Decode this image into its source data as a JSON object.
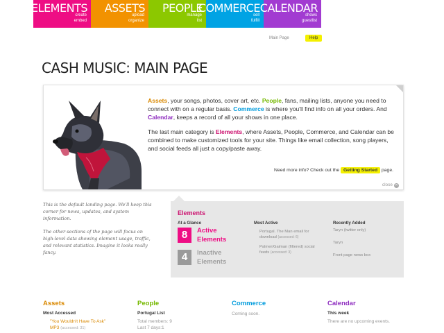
{
  "nav": {
    "tabs": [
      {
        "name": "Elements",
        "sub1": "create",
        "sub2": "embed",
        "color": "#ee0d84"
      },
      {
        "name": "Assets",
        "sub1": "upload",
        "sub2": "organize",
        "color": "#f29200"
      },
      {
        "name": "People",
        "sub1": "manage",
        "sub2": "list",
        "color": "#8cc800"
      },
      {
        "name": "Commerce",
        "sub1": "sell",
        "sub2": "fulfill",
        "color": "#00a3e4"
      },
      {
        "name": "Calendar",
        "sub1": "shows",
        "sub2": "guestlist",
        "color": "#a23bd1"
      }
    ]
  },
  "subnav": {
    "main_page": "Main Page",
    "help": "Help"
  },
  "page_title": "Cash Music: Main Page",
  "intro": {
    "p1": [
      {
        "t": "Assets",
        "c": "kw kw-assets"
      },
      {
        "t": ", your songs, photos, cover art, etc. ",
        "c": ""
      },
      {
        "t": "People",
        "c": "kw kw-people"
      },
      {
        "t": ", fans, mailing lists, anyone you need to connect with on a regular basis. ",
        "c": ""
      },
      {
        "t": "Commerce",
        "c": "kw kw-commerce"
      },
      {
        "t": " is where you'll find info on all your orders. And ",
        "c": ""
      },
      {
        "t": "Calendar",
        "c": "kw kw-calendar"
      },
      {
        "t": ", keeps a record of all your shows in one place.",
        "c": ""
      }
    ],
    "p2": [
      {
        "t": "The last main category is ",
        "c": ""
      },
      {
        "t": "Elements",
        "c": "kw kw-elements"
      },
      {
        "t": ", where Assets, People, Commerce, and Calendar can be combined to make customized tools for your site. Things like email collection, song players, and social feeds all just a copy/paste away.",
        "c": ""
      }
    ],
    "more_prefix": "Need more info? Check out the",
    "getting_started": "Getting Started",
    "more_suffix": "page.",
    "close": "close"
  },
  "sidenote": {
    "p1": "This is the default landing page. We'll keep this corner for news, updates, and system information.",
    "p2": "The other sections of the page will focus on high-level data showing element usage, traffic, and relevant statistics. Imagine it looks really fancy."
  },
  "elements_panel": {
    "title": "Elements",
    "at_a_glance": "At a Glance",
    "active_count": "8",
    "active_label_1": "Active",
    "active_label_2": "Elements",
    "inactive_count": "4",
    "inactive_label_1": "Inactive",
    "inactive_label_2": "Elements",
    "most_active": "Most Active",
    "most_active_items": [
      {
        "name": "Portugal. The Man email for download",
        "accessed": "(accessed: 6)"
      },
      {
        "name": "Palmer/Gaiman (filtered) social feeds",
        "accessed": "(accessed: 3)"
      }
    ],
    "recently_added": "Recently Added",
    "recent_items": [
      "Taryn (twitter only)",
      "Taryn",
      "Front page news box"
    ],
    "active_color": "#ee0d84",
    "inactive_color": "#9a9a9a"
  },
  "bottom": {
    "assets": {
      "title": "Assets",
      "sub": "Most Accessed",
      "song": "\"You Wouldn't Have To Ask\"",
      "song2": "MP3",
      "accessed": "(accessed: 31)"
    },
    "people": {
      "title": "People",
      "sub": "Portugal List",
      "line1": "Total members: 9",
      "line2": "Last 7 days:1"
    },
    "commerce": {
      "title": "Commerce",
      "line1": "Coming soon."
    },
    "calendar": {
      "title": "Calendar",
      "sub": "This week",
      "line1": "There are no upcoming events."
    }
  }
}
